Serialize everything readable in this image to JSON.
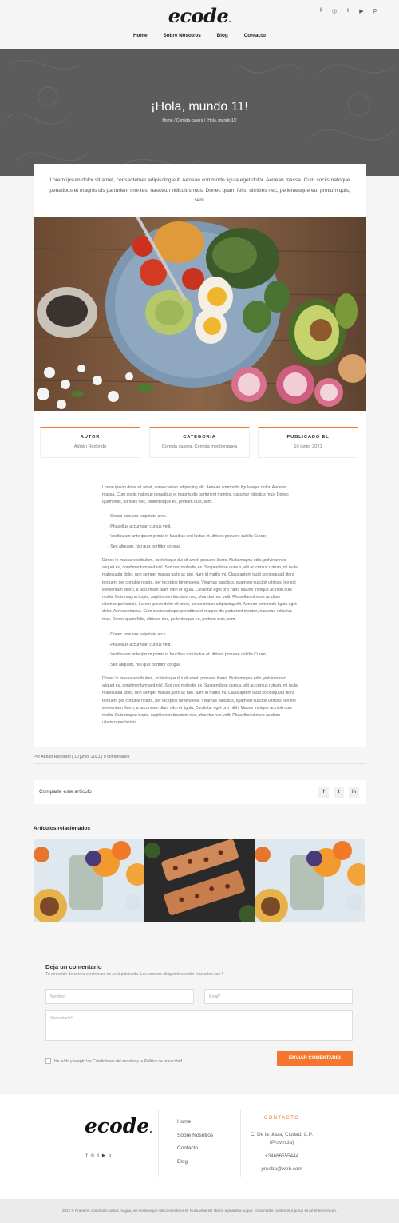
{
  "header": {
    "logo": "ecode",
    "nav": [
      "Home",
      "Sobre Nosotros",
      "Blog",
      "Contacto"
    ],
    "social_icons": [
      "facebook-icon",
      "instagram-icon",
      "twitter-icon",
      "youtube-icon",
      "pinterest-icon"
    ]
  },
  "hero": {
    "title": "¡Hola, mundo 11!",
    "breadcrumb": "Home / Comida casera / ¡Hola, mundo 11!"
  },
  "post": {
    "intro": "Lorem ipsum dolor sit amet, consectetuer adipiscing elit. Aenean commodo ligula eget dolor. Aenean massa. Cum sociis natoque penatibus et magnis dis parturient montes, nascetur ridiculus mus. Donec quam felis, ultricies nec, pellentesque eu, pretium quis, sem.",
    "meta": [
      {
        "title": "AUTOR",
        "value": "Adrián Redondo"
      },
      {
        "title": "CATEGORÍA",
        "value": "Comida casera, Comida mediterránea"
      },
      {
        "title": "PUBLICADO EL",
        "value": "10 junio, 2021"
      }
    ],
    "para1": "Lorem ipsum dolor sit amet, consectetuer adipiscing elit. Aenean commodo ligula eget dolor. Aenean massa. Cum sociis natoque penatibus et magnis dis parturient montes, nascetur ridiculus mus. Donec quam felis, ultricies nec, pellentesque eu, pretium quis, sem.",
    "list1": [
      "Donec posuere vulputate arcu.",
      "Phasellus accumsan cursus velit.",
      "Vestibulum ante ipsum primis in faucibus orci luctus et ultrices posuere cubilia Curae;",
      "Sed aliquam, nisi quis porttitor congue"
    ],
    "para2": "Donec in massa vestibulum, scelerisque dui sit amet, posuere libero. Nulla magna odio, pulvinar nec aliquet eu, condimentum sed nisl. Sed nec molestie ex. Suspendisse cursus, elit ac cursus rutrum, mi nulla malesuada dolor, non semper massa justo ac nisi. Nam id mattis mi. Class aptent taciti sociosqu ad litora torquent per conubia nostra, per inceptos himenaeos. Vivamus faucibus, quam eu suscipit ultrices, leo est elementum libero, a accumsan diam nibh et ligula. Curabitur eget orci nibh. Mauris tristique ac nibh quis mollis. Duis magna turpis, sagittis non tincidunt nec, pharetra nec velit. Phasellus ultrices ac diam ullamcorper lacinia. Lorem ipsum dolor sit amet, consectetuer adipiscing elit. Aenean commodo ligula eget dolor. Aenean massa. Cum sociis natoque penatibus et magnis dis parturient montes, nascetur ridiculus mus. Donec quam felis, ultricies nec, pellentesque eu, pretium quis, sem.",
    "list2": [
      "Donec posuere vulputate arcu.",
      "Phasellus accumsan cursus velit.",
      "Vestibulum ante ipsum primis in faucibus orci luctus et ultrices posuere cubilia Curae;",
      "Sed aliquam, nisi quis porttitor congue"
    ],
    "para3": "Donec in massa vestibulum, scelerisque dui sit amet, posuere libero. Nulla magna odio, pulvinar nec aliquet eu, condimentum sed nisl. Sed nec molestie ex. Suspendisse cursus, elit ac cursus rutrum, mi nulla malesuada dolor, non semper massa justo ac nisi. Nam id mattis mi. Class aptent taciti sociosqu ad litora torquent per conubia nostra, per inceptos himenaeos. Vivamus faucibus, quam eu suscipit ultrices, leo est elementum libero, a accumsan diam nibh et ligula. Curabitur eget orci nibh. Mauris tristique ac nibh quis mollis. Duis magna turpis, sagittis non tincidunt nec, pharetra nec velit. Phasellus ultrices ac diam ullamcorper lacinia.",
    "byline": "Por Adrián Redondo | 10 junio, 2021 | 0 comentarios"
  },
  "share": {
    "label": "Comparte este artículo",
    "icons": [
      "f",
      "t",
      "in"
    ]
  },
  "related": {
    "title": "Artículos relacionados"
  },
  "comment": {
    "title": "Deja un comentario",
    "note": "Tu dirección de correo electrónico no será publicada. Los campos obligatorios están marcados con *",
    "name_placeholder": "Nombre*",
    "email_placeholder": "Email*",
    "comment_placeholder": "Comentario*",
    "consent": "He leído y acepto las Condiciones del servicio y la Política de privacidad",
    "submit": "ENVIAR COMENTARIO"
  },
  "footer": {
    "logo": "ecode",
    "links": [
      "Home",
      "Sobre Nosotros",
      "Contacto",
      "Blog"
    ],
    "contact_title": "CONTACTO",
    "address": "C/ De la plaza, Ciudad, C.P. (Provincia)",
    "phone": "+34666555444",
    "email": "prueba@web.com",
    "copyright": "2021 © Praesent commodo cursus magna, vel scelerisque nisl consectetur et. Nulla vitae elit libero, a pharetra augue. Cras mattis consectetur purus sit amet fermentum."
  },
  "colors": {
    "accent": "#f47730",
    "hero_bg": "#5c5c5c",
    "page_bg": "#f5f5f5"
  }
}
